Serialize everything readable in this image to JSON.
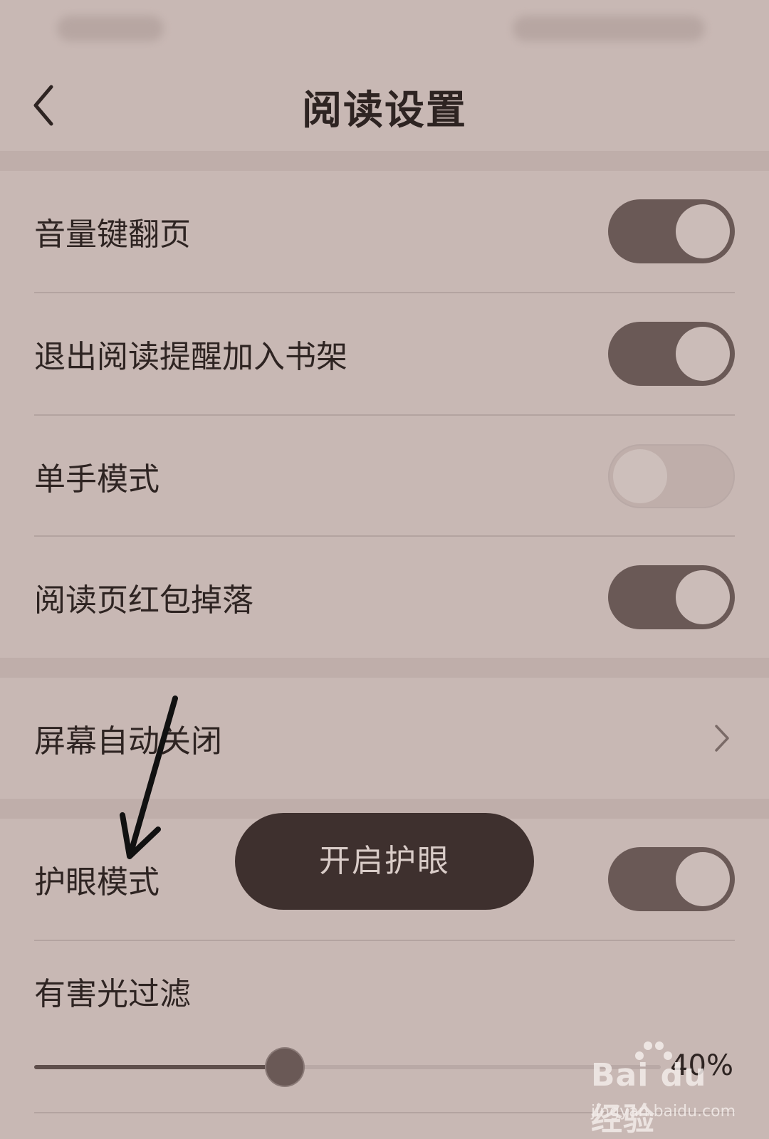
{
  "header": {
    "title": "阅读设置"
  },
  "settings": [
    {
      "label": "音量键翻页",
      "state": "on"
    },
    {
      "label": "退出阅读提醒加入书架",
      "state": "on"
    },
    {
      "label": "单手模式",
      "state": "off"
    },
    {
      "label": "阅读页红包掉落",
      "state": "on"
    }
  ],
  "screen_off": {
    "label": "屏幕自动关闭"
  },
  "eye_care": {
    "label": "护眼模式",
    "state": "on",
    "toast": "开启护眼"
  },
  "filter": {
    "label": "有害光过滤",
    "value": 40,
    "value_text": "40%"
  },
  "watermark": {
    "logo": "Bai du 经验",
    "url": "jingyan.baidu.com"
  },
  "colors": {
    "background": "#c8b8b4",
    "toggle_on": "#6a5956",
    "toast_bg": "#3e302e"
  }
}
